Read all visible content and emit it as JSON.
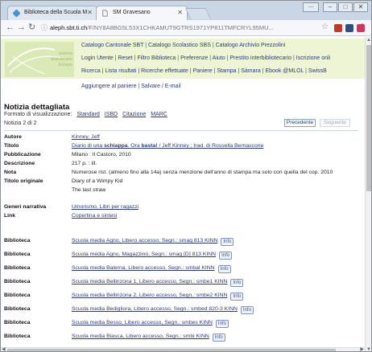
{
  "browser": {
    "tabs": [
      {
        "label": "Biblioteca della Scuola M",
        "active": false
      },
      {
        "label": "SM Gravesano",
        "active": true
      }
    ],
    "window_controls": {
      "user": "‒‒",
      "minimize": "–",
      "maximize": "□",
      "close": "✕"
    },
    "url_host": "aleph.sbt.ti.ch",
    "url_path": "/F/NY8A8BG5L53X1CHKAMUT9GTRS1971YP811TMFCRYL95MU...",
    "icons": {
      "back": "back-arrow-icon",
      "forward": "forward-arrow-icon",
      "reload": "reload-icon",
      "lock": "lock-icon",
      "star": "star-icon",
      "menu": "vertical-dots-icon"
    },
    "ext_colors": [
      "#c0392b",
      "#2f4f7f",
      "#d8345f"
    ]
  },
  "header": {
    "logo_text": [
      "sistema",
      "bibliotecario",
      "ticinese"
    ],
    "nav_row1": [
      "Catalogo Cantonale SBT",
      "Catalogo Scolastico SBS",
      "Catalogo Archivio Prezzolini"
    ],
    "nav_row2": [
      "Login Utente",
      "Reset",
      "Filtro Biblioteca",
      "Preferenze",
      "Aiuto",
      "Prestito interbibliotecario",
      "Iscrizione onli"
    ],
    "nav_row3": [
      "Ricerca",
      "Lista risultati",
      "Ricerche effettuate",
      "Paniere",
      "Stampa",
      "Sàmara",
      "Ebook @MLOL",
      "SwissB"
    ],
    "colors": {
      "band": "#eef5d4",
      "link": "#2c3a7a"
    }
  },
  "actions": {
    "add_basket": "Aggiungere al paniere",
    "save_email": "Salvare / E-mail",
    "sep": "|"
  },
  "record": {
    "heading": "Notizia dettagliata",
    "format_label": "Formato di visualizzazione:",
    "formats": [
      "Standard",
      "ISBD",
      "Citazione",
      "MARC"
    ],
    "count": "Notizia 2 di 2",
    "prev_button": "Precedente",
    "next_button": "Seguente",
    "fields": [
      {
        "key": "Autore",
        "value": "Kinney, Jeff",
        "link": true
      },
      {
        "key": "Titolo",
        "value_parts": [
          "Diario di una ",
          "schiappa",
          ". Ora ",
          "basta!",
          " / Jeff Kinney ; trad. di Rossella Bernascone"
        ],
        "link": true
      },
      {
        "key": "Pubblicazione",
        "value": "Milano : Il Castoro, 2010",
        "link": false
      },
      {
        "key": "Descrizione",
        "value": "217 p. : ill.",
        "link": false
      },
      {
        "key": "Nota",
        "value": "Numerose rist. (almeno fino alla 14a) senza menzione dell'anno di stampa ma solo con quella del cop. 2010",
        "link": false
      },
      {
        "key": "Titolo originale",
        "value": "Diary of a Wimpy Kid",
        "link": false
      },
      {
        "key": "",
        "value": "The last straw",
        "link": false
      },
      {
        "key": "Generi narrativa",
        "value": "Umorismo, Libri per ragazzi",
        "link": true
      },
      {
        "key": "Link",
        "value": "Copertina e sintesi",
        "link": true
      }
    ],
    "holdings_label": "Biblioteca",
    "info_label": "Info",
    "holdings": [
      "Scuola media Agno, Libero accesso, Segn.: smag 813 KINN",
      "Scuola media Agno, Magazzino, Segn.: smag [D] 813 KINN",
      "Scuola media Balerna, Libero accesso, Segn.: smbal KINN",
      "Scuola media Bellinzona 1, Libero accesso, Segn.: smbe1 KINN",
      "Scuola media Bellinzona 2, Libero accesso, Segn.: smbe2 KINN",
      "Scuola media Bedigliora, Libero accesso, Segn.: smbed 820-3 KINN",
      "Scuola media Besso, Libero accesso, Segn.: smbes KINN",
      "Scuola media Biasca, Libero accesso, Segn.: smbi KINN"
    ]
  }
}
